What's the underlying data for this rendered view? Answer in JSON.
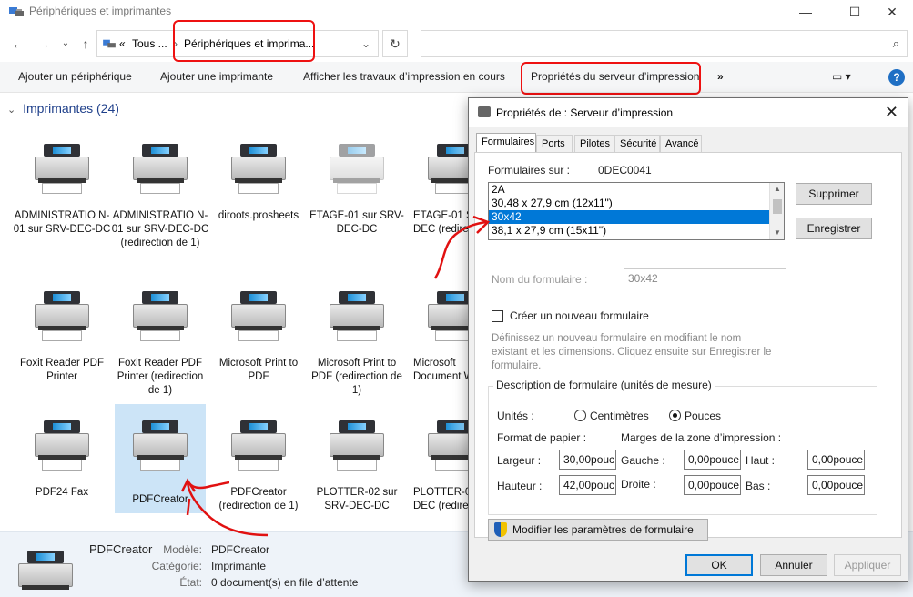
{
  "window": {
    "title": "Périphériques et imprimantes",
    "controls": {
      "minimize": "—",
      "maximize": "☐",
      "close": "✕"
    }
  },
  "address": {
    "crumb_prefix": "«",
    "crumb_parent": "Tous ...",
    "crumb_current": "Périphériques et imprima...",
    "search_placeholder": ""
  },
  "commands": {
    "add_device": "Ajouter un périphérique",
    "add_printer": "Ajouter une imprimante",
    "print_jobs": "Afficher les travaux d’impression en cours",
    "server_props": "Propriétés du serveur d’impression",
    "more": "»",
    "help": "?"
  },
  "group": {
    "header": "Imprimantes (24)"
  },
  "printers": [
    {
      "label": "ADMINISTRATIO N-01 sur SRV-DEC-DC",
      "faded": false
    },
    {
      "label": "ADMINISTRATIO N-01 sur SRV-DEC-DC (redirection de 1)",
      "faded": false
    },
    {
      "label": "diroots.prosheets",
      "faded": false
    },
    {
      "label": "ETAGE-01 sur SRV-DEC-DC",
      "faded": true
    },
    {
      "label": "ETAGE-01 SRV-DEC (redirection",
      "faded": false
    },
    {
      "label": "Foxit Reader PDF Printer",
      "faded": false
    },
    {
      "label": "Foxit Reader PDF Printer (redirection de 1)",
      "faded": false
    },
    {
      "label": "Microsoft Print to PDF",
      "faded": false
    },
    {
      "label": "Microsoft Print to PDF (redirection de 1)",
      "faded": false
    },
    {
      "label": "Microsoft Document W",
      "faded": false
    },
    {
      "label": "PDF24 Fax",
      "faded": false
    },
    {
      "label": "PDFCreator",
      "faded": false
    },
    {
      "label": "PDFCreator (redirection de 1)",
      "faded": false
    },
    {
      "label": "PLOTTER-02 sur SRV-DEC-DC",
      "faded": false
    },
    {
      "label": "PLOTTER-0 SRV-DEC (redirection",
      "faded": false
    }
  ],
  "details": {
    "name": "PDFCreator",
    "model_label": "Modèle:",
    "model": "PDFCreator",
    "category_label": "Catégorie:",
    "category": "Imprimante",
    "state_label": "État:",
    "state": "0 document(s) en file d’attente"
  },
  "dialog": {
    "title": "Propriétés de : Serveur d’impression",
    "tabs": [
      "Formulaires",
      "Ports",
      "Pilotes",
      "Sécurité",
      "Avancé"
    ],
    "forms_on_label": "Formulaires sur :",
    "server_name": "0DEC0041",
    "forms_list": [
      "2A",
      "30,48 x 27,9 cm (12x11\")",
      "30x42",
      "38,1 x 27,9 cm (15x11\")"
    ],
    "selected_form": "30x42",
    "delete_button": "Supprimer",
    "save_button": "Enregistrer",
    "form_name_label": "Nom du formulaire :",
    "form_name_value": "30x42",
    "create_new_label": "Créer un nouveau formulaire",
    "create_new_checked": false,
    "help_text": "Définissez un nouveau formulaire en modifiant le nom existant et les dimensions. Cliquez ensuite sur Enregistrer le formulaire.",
    "description_group": "Description de formulaire (unités de mesure)",
    "units_label": "Unités :",
    "unit_cm": "Centimètres",
    "unit_in": "Pouces",
    "unit_selected": "Pouces",
    "paper_size_label": "Format de papier :",
    "margins_label": "Marges de la zone d’impression :",
    "width_label": "Largeur :",
    "width_value": "30,00pouc",
    "height_label": "Hauteur :",
    "height_value": "42,00pouc",
    "left_label": "Gauche :",
    "left_value": "0,00pouce",
    "right_label": "Droite :",
    "right_value": "0,00pouce",
    "top_label": "Haut :",
    "top_value": "0,00pouce",
    "bottom_label": "Bas :",
    "bottom_value": "0,00pouce",
    "modify_button": "Modifier les paramètres de formulaire",
    "ok_button": "OK",
    "cancel_button": "Annuler",
    "apply_button": "Appliquer"
  },
  "annotation_color": "#e11111"
}
